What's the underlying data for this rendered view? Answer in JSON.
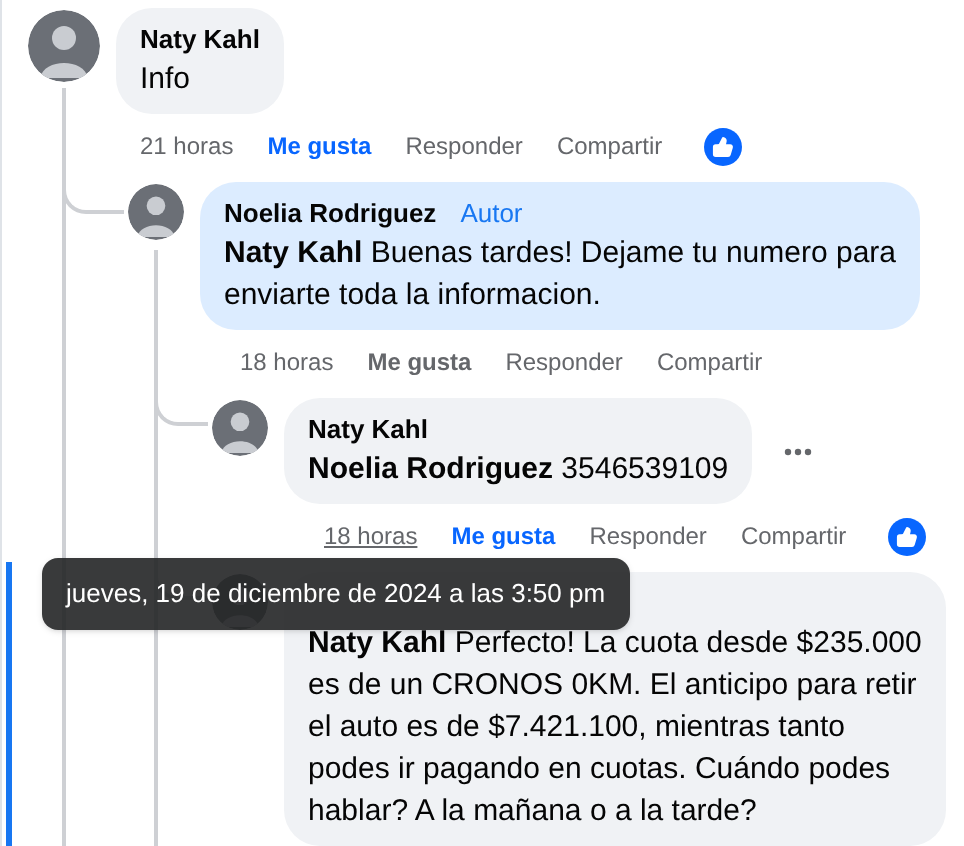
{
  "comments": [
    {
      "author": "Naty Kahl",
      "lines": [
        "Info"
      ],
      "highlighted": false,
      "time": "21 horas",
      "hovered": false,
      "actions": [
        {
          "label": "Me gusta",
          "kind": "like",
          "liked": true
        },
        {
          "label": "Responder",
          "kind": "reply"
        },
        {
          "label": "Compartir",
          "kind": "share"
        }
      ],
      "reactions": true,
      "children": [
        {
          "author": "Noelia Rodriguez",
          "badge": "Autor",
          "lines": [
            "**Naty Kahl** Buenas tardes! Dejame tu numero para",
            "enviarte toda la informacion."
          ],
          "highlighted": true,
          "time": "18 horas",
          "hovered": false,
          "actions": [
            {
              "label": "Me gusta",
              "kind": "like",
              "liked": false
            },
            {
              "label": "Responder",
              "kind": "reply"
            },
            {
              "label": "Compartir",
              "kind": "share"
            }
          ],
          "children": [
            {
              "author": "Naty Kahl",
              "lines": [
                "**Noelia Rodriguez** 3546539109"
              ],
              "highlighted": false,
              "time": "18 horas",
              "hovered": true,
              "actions": [
                {
                  "label": "Me gusta",
                  "kind": "like",
                  "liked": true
                },
                {
                  "label": "Responder",
                  "kind": "reply"
                },
                {
                  "label": "Compartir",
                  "kind": "share"
                }
              ],
              "reactions": true,
              "show_menu": true
            },
            {
              "lines": [
                "**Naty Kahl** Perfecto! La cuota desde $235.000",
                "es de un CRONOS 0KM. El anticipo para retir",
                "el auto es de $7.421.100, mientras tanto",
                "podes ir pagando en cuotas. Cuándo podes",
                "hablar? A la mañana o a la tarde?"
              ],
              "highlighted": false,
              "focused": true
            }
          ]
        }
      ]
    }
  ],
  "tooltip": {
    "text": "jueves, 19 de diciembre de 2024 a las 3:50 pm"
  }
}
